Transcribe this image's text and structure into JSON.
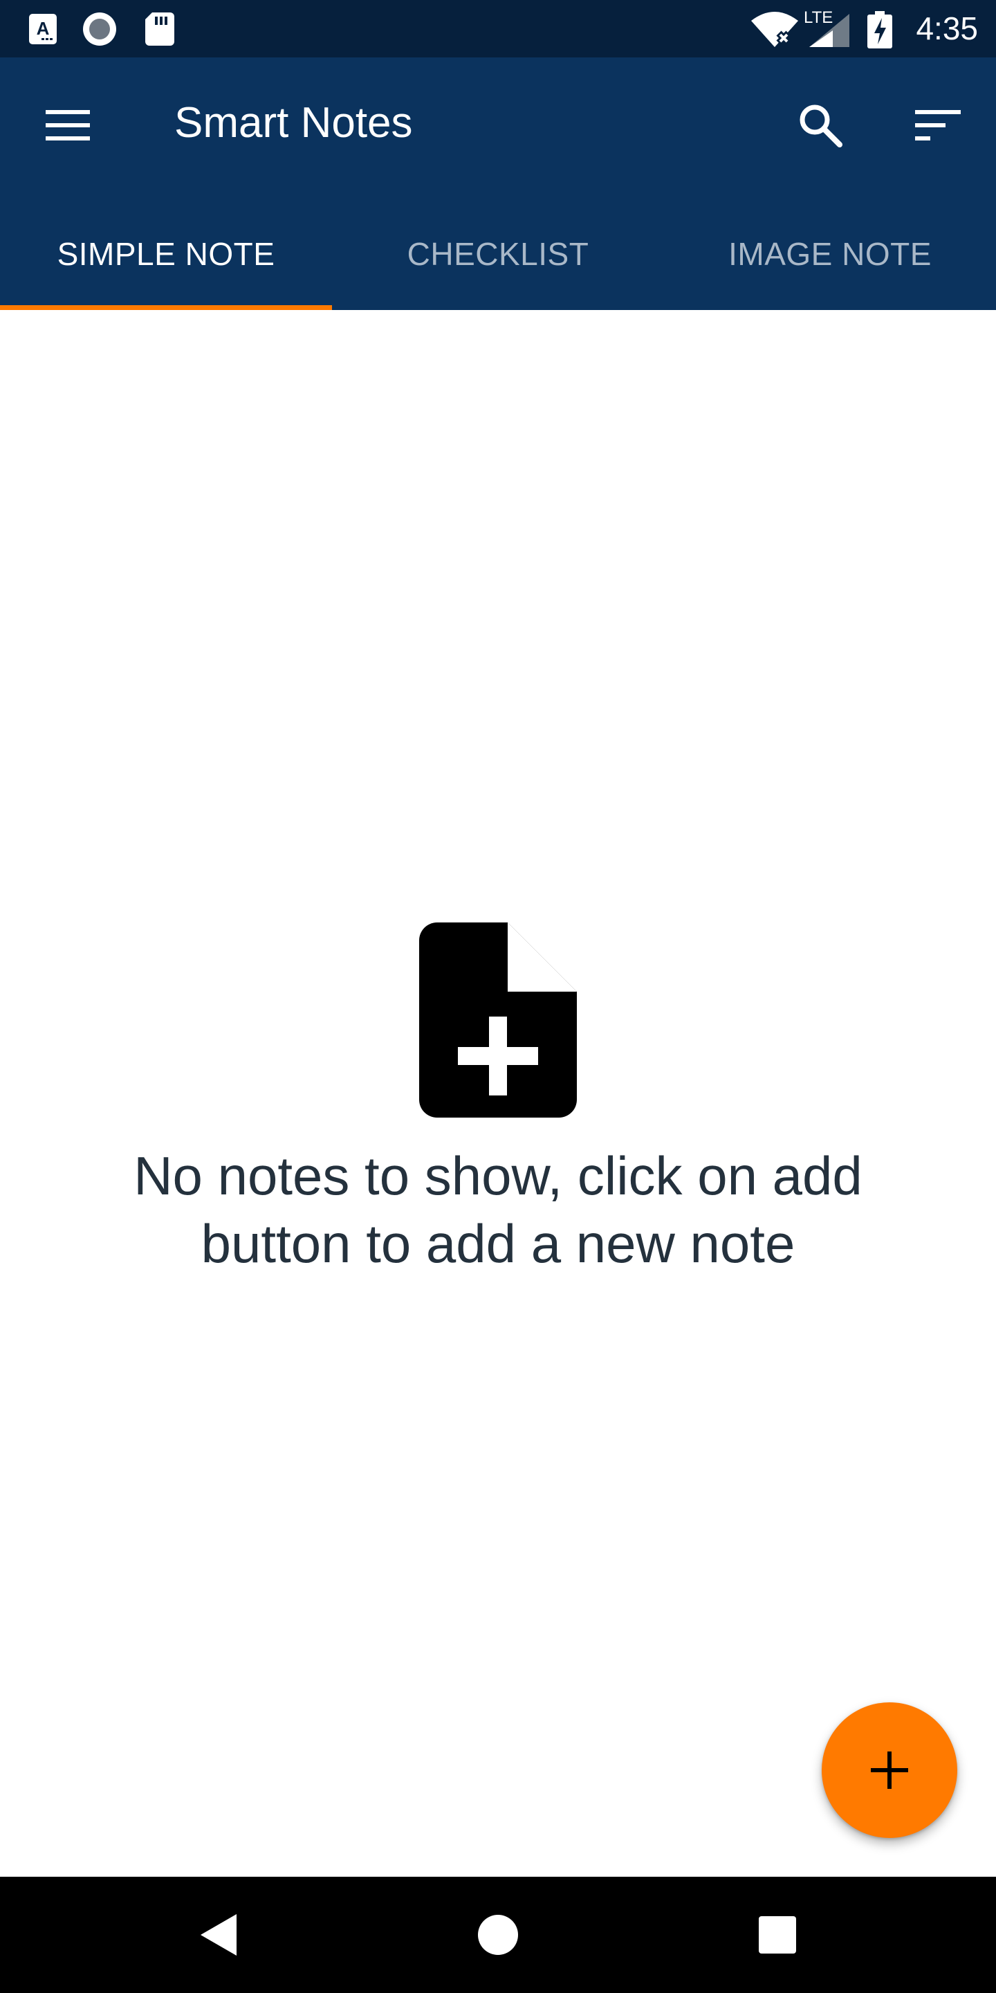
{
  "status_bar": {
    "time": "4:35",
    "network_label": "LTE",
    "icons": [
      "text-a-icon",
      "record-icon",
      "sd-card-icon",
      "wifi-off-icon",
      "signal-icon",
      "battery-charging-icon"
    ]
  },
  "app_bar": {
    "title": "Smart Notes",
    "menu_icon": "hamburger-menu-icon",
    "search_icon": "search-icon",
    "sort_icon": "sort-icon"
  },
  "tabs": [
    {
      "label": "SIMPLE NOTE",
      "active": true
    },
    {
      "label": "CHECKLIST",
      "active": false
    },
    {
      "label": "IMAGE NOTE",
      "active": false
    }
  ],
  "empty_state": {
    "icon": "note-add-icon",
    "message": "No notes to show, click on add button to add a new note"
  },
  "fab": {
    "icon": "plus-icon"
  },
  "nav_bar": {
    "icons": [
      "back-icon",
      "home-icon",
      "recents-icon"
    ]
  },
  "colors": {
    "status_bar": "#06203d",
    "app_bar": "#0b335e",
    "accent": "#ff7a00",
    "tab_active_text": "#ffffff",
    "tab_inactive_text": "#a9b8c8",
    "message_text": "#24313d"
  }
}
